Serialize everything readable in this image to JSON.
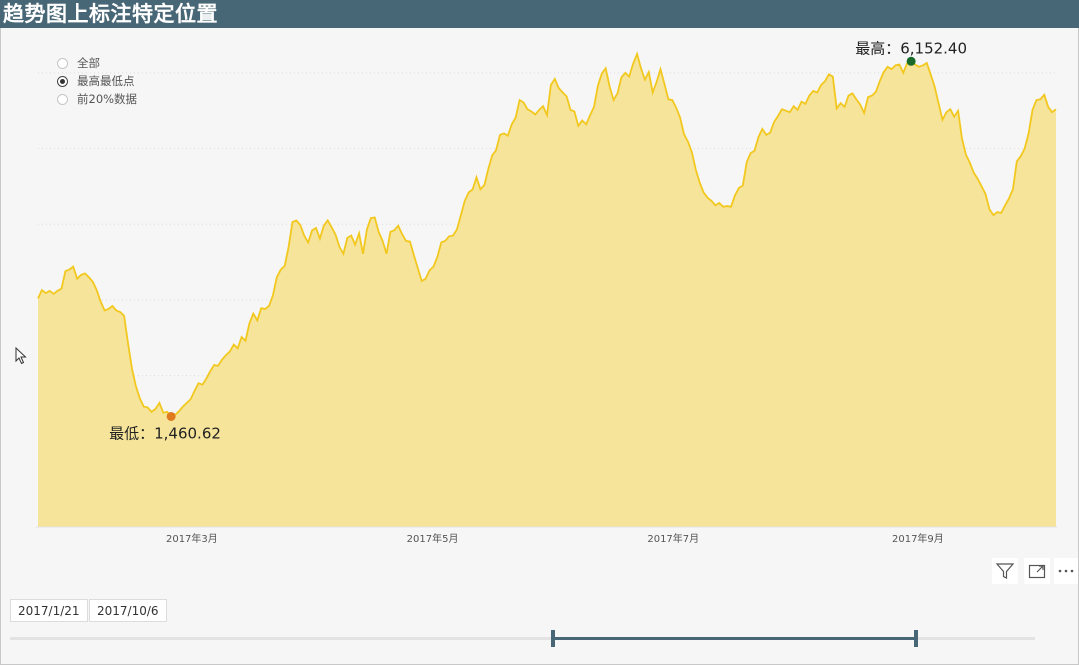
{
  "header": {
    "title": "趋势图上标注特定位置"
  },
  "filter": {
    "options": [
      {
        "label": "全部",
        "selected": false
      },
      {
        "label": "最高最低点",
        "selected": true
      },
      {
        "label": "前20%数据",
        "selected": false
      }
    ]
  },
  "colors": {
    "area_fill": "#f5e49a",
    "area_line": "#f2c81f",
    "max_marker": "#1a6b2b",
    "min_marker": "#e07a1f",
    "accent": "#486776"
  },
  "chart_data": {
    "type": "area",
    "x_range": [
      "2017-01-21",
      "2017-10-06"
    ],
    "x_ticks": [
      "2017年3月",
      "2017年5月",
      "2017年7月",
      "2017年9月"
    ],
    "y_range": [
      0,
      6500
    ],
    "grid": "horizontal-dotted",
    "values": [
      3020,
      3130,
      3090,
      3120,
      3080,
      3120,
      3150,
      3380,
      3400,
      3440,
      3280,
      3330,
      3350,
      3300,
      3240,
      3130,
      2980,
      2860,
      2880,
      2920,
      2860,
      2840,
      2790,
      2420,
      2090,
      1860,
      1700,
      1590,
      1580,
      1520,
      1560,
      1640,
      1510,
      1520,
      1460.62,
      1480,
      1530,
      1590,
      1640,
      1690,
      1800,
      1900,
      1880,
      1960,
      2060,
      2140,
      2130,
      2210,
      2270,
      2320,
      2410,
      2360,
      2510,
      2460,
      2690,
      2820,
      2730,
      2890,
      2880,
      2920,
      3060,
      3300,
      3400,
      3450,
      3700,
      4030,
      4050,
      3990,
      3850,
      3760,
      3920,
      3950,
      3810,
      3980,
      4050,
      3960,
      3860,
      3700,
      3610,
      3820,
      3850,
      3730,
      3880,
      3610,
      3930,
      4080,
      4090,
      3900,
      3780,
      3610,
      3900,
      3920,
      3980,
      3870,
      3780,
      3770,
      3590,
      3420,
      3250,
      3280,
      3390,
      3440,
      3570,
      3760,
      3780,
      3840,
      3850,
      3930,
      4120,
      4310,
      4420,
      4460,
      4620,
      4460,
      4520,
      4730,
      4910,
      4980,
      5180,
      5200,
      5170,
      5320,
      5410,
      5640,
      5610,
      5520,
      5490,
      5450,
      5510,
      5560,
      5440,
      5840,
      5920,
      5800,
      5740,
      5690,
      5510,
      5490,
      5300,
      5370,
      5320,
      5440,
      5550,
      5830,
      5990,
      6060,
      5820,
      5640,
      5730,
      5940,
      6000,
      5950,
      6120,
      6250,
      6060,
      5910,
      6010,
      5740,
      5880,
      6050,
      5850,
      5650,
      5640,
      5540,
      5410,
      5190,
      5090,
      4950,
      4720,
      4550,
      4420,
      4350,
      4310,
      4250,
      4280,
      4230,
      4240,
      4230,
      4380,
      4480,
      4510,
      4820,
      4940,
      4970,
      5150,
      5260,
      5180,
      5210,
      5350,
      5430,
      5520,
      5500,
      5480,
      5560,
      5510,
      5620,
      5590,
      5700,
      5760,
      5740,
      5840,
      5890,
      5980,
      5950,
      5530,
      5600,
      5550,
      5700,
      5730,
      5650,
      5580,
      5470,
      5680,
      5700,
      5750,
      5890,
      6010,
      6080,
      6050,
      6100,
      6110,
      6000,
      6130,
      6152.4,
      6110,
      6080,
      6100,
      6130,
      5980,
      5820,
      5600,
      5380,
      5480,
      5520,
      5420,
      5500,
      5130,
      4920,
      4810,
      4680,
      4600,
      4500,
      4400,
      4200,
      4120,
      4160,
      4150,
      4250,
      4340,
      4460,
      4830,
      4900,
      5000,
      5200,
      5510,
      5640,
      5650,
      5710,
      5550,
      5480,
      5520
    ],
    "annotations": [
      {
        "type": "max",
        "label": "最高：",
        "value_text": "6,152.40",
        "value": 6152.4
      },
      {
        "type": "min",
        "label": "最低：",
        "value_text": "1,460.62",
        "value": 1460.62
      }
    ]
  },
  "toolbar": {
    "filter_icon": "filter-icon",
    "focus_icon": "focus-mode-icon",
    "more_icon": "more-options-icon"
  },
  "date_range": {
    "start": "2017/1/21",
    "end": "2017/10/6"
  }
}
